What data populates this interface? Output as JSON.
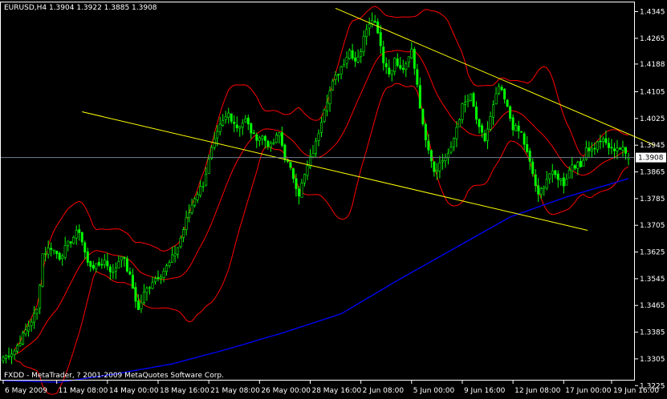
{
  "header": {
    "symbol_line": "EURUSD,H4  1.3904 1.3922 1.3885 1.3908"
  },
  "footer": {
    "copyright": "FXDD - MetaTrader, ? 2001-2009 MetaQuotes Software Corp."
  },
  "colors": {
    "background": "#000000",
    "frame": "#ffffff",
    "candle": "#00ff00",
    "bollinger": "#ff0000",
    "moving_average": "#0000ff",
    "trendline": "#ffff00",
    "price_line": "#708090",
    "price_label_bg": "#ffffff",
    "price_label_text": "#000000",
    "axis_text": "#ffffff"
  },
  "chart_data": {
    "type": "candlestick",
    "symbol": "EURUSD",
    "timeframe": "H4",
    "ohlc_current": {
      "open": 1.3904,
      "high": 1.3922,
      "low": 1.3885,
      "close": 1.3908
    },
    "current_price_label": "1.3908",
    "y_range": [
      1.324,
      1.4375
    ],
    "y_ticks": [
      {
        "value": 1.4345,
        "label": "1.4345"
      },
      {
        "value": 1.4265,
        "label": "1.4265"
      },
      {
        "value": 1.4188,
        "label": "1.4188"
      },
      {
        "value": 1.4105,
        "label": "1.4105"
      },
      {
        "value": 1.4025,
        "label": "1.4025"
      },
      {
        "value": 1.3945,
        "label": "1.3945"
      },
      {
        "value": 1.3865,
        "label": "1.3865"
      },
      {
        "value": 1.3785,
        "label": "1.3785"
      },
      {
        "value": 1.3705,
        "label": "1.3705"
      },
      {
        "value": 1.3625,
        "label": "1.3625"
      },
      {
        "value": 1.3545,
        "label": "1.3545"
      },
      {
        "value": 1.3465,
        "label": "1.3465"
      },
      {
        "value": 1.3385,
        "label": "1.3385"
      },
      {
        "value": 1.3305,
        "label": "1.3305"
      },
      {
        "value": 1.3225,
        "label": "1.3225"
      }
    ],
    "x_ticks": [
      {
        "bar": 0,
        "label": "6 May 2009"
      },
      {
        "bar": 19,
        "label": "11 May 08:00"
      },
      {
        "bar": 37,
        "label": "14 May 00:00"
      },
      {
        "bar": 55,
        "label": "18 May 16:00"
      },
      {
        "bar": 73,
        "label": "21 May 08:00"
      },
      {
        "bar": 91,
        "label": "26 May 00:00"
      },
      {
        "bar": 109,
        "label": "28 May 16:00"
      },
      {
        "bar": 127,
        "label": "2 Jun 08:00"
      },
      {
        "bar": 145,
        "label": "5 Jun 00:00"
      },
      {
        "bar": 163,
        "label": "9 Jun 16:00"
      },
      {
        "bar": 181,
        "label": "12 Jun 08:00"
      },
      {
        "bar": 199,
        "label": "17 Jun 00:00"
      },
      {
        "bar": 216,
        "label": "19 Jun 16:00"
      }
    ],
    "close_anchors": [
      [
        0,
        1.331
      ],
      [
        4,
        1.333
      ],
      [
        8,
        1.339
      ],
      [
        12,
        1.345
      ],
      [
        14,
        1.362
      ],
      [
        17,
        1.364
      ],
      [
        20,
        1.361
      ],
      [
        24,
        1.366
      ],
      [
        27,
        1.369
      ],
      [
        30,
        1.359
      ],
      [
        33,
        1.358
      ],
      [
        36,
        1.36
      ],
      [
        39,
        1.356
      ],
      [
        42,
        1.362
      ],
      [
        45,
        1.355
      ],
      [
        48,
        1.345
      ],
      [
        50,
        1.35
      ],
      [
        53,
        1.354
      ],
      [
        56,
        1.356
      ],
      [
        59,
        1.359
      ],
      [
        62,
        1.364
      ],
      [
        65,
        1.372
      ],
      [
        68,
        1.379
      ],
      [
        71,
        1.383
      ],
      [
        74,
        1.393
      ],
      [
        77,
        1.4
      ],
      [
        80,
        1.404
      ],
      [
        83,
        1.4
      ],
      [
        86,
        1.402
      ],
      [
        89,
        1.397
      ],
      [
        92,
        1.397
      ],
      [
        95,
        1.394
      ],
      [
        98,
        1.398
      ],
      [
        100,
        1.391
      ],
      [
        103,
        1.385
      ],
      [
        105,
        1.38
      ],
      [
        108,
        1.388
      ],
      [
        111,
        1.395
      ],
      [
        114,
        1.406
      ],
      [
        117,
        1.413
      ],
      [
        120,
        1.418
      ],
      [
        123,
        1.423
      ],
      [
        125,
        1.42
      ],
      [
        127,
        1.423
      ],
      [
        129,
        1.43
      ],
      [
        131,
        1.433
      ],
      [
        133,
        1.429
      ],
      [
        135,
        1.42
      ],
      [
        137,
        1.416
      ],
      [
        139,
        1.42
      ],
      [
        141,
        1.417
      ],
      [
        143,
        1.418
      ],
      [
        145,
        1.423
      ],
      [
        147,
        1.413
      ],
      [
        149,
        1.4
      ],
      [
        151,
        1.394
      ],
      [
        153,
        1.387
      ],
      [
        156,
        1.39
      ],
      [
        159,
        1.393
      ],
      [
        161,
        1.4
      ],
      [
        163,
        1.406
      ],
      [
        166,
        1.409
      ],
      [
        169,
        1.399
      ],
      [
        171,
        1.396
      ],
      [
        174,
        1.406
      ],
      [
        176,
        1.412
      ],
      [
        178,
        1.408
      ],
      [
        181,
        1.4
      ],
      [
        184,
        1.398
      ],
      [
        186,
        1.392
      ],
      [
        188,
        1.386
      ],
      [
        190,
        1.379
      ],
      [
        192,
        1.383
      ],
      [
        194,
        1.386
      ],
      [
        197,
        1.385
      ],
      [
        199,
        1.383
      ],
      [
        202,
        1.389
      ],
      [
        205,
        1.388
      ],
      [
        207,
        1.394
      ],
      [
        209,
        1.393
      ],
      [
        212,
        1.396
      ],
      [
        214,
        1.395
      ],
      [
        216,
        1.393
      ],
      [
        218,
        1.394
      ],
      [
        220,
        1.393
      ],
      [
        222,
        1.3908
      ]
    ],
    "moving_average_anchors": [
      [
        0,
        1.324
      ],
      [
        20,
        1.3235
      ],
      [
        40,
        1.326
      ],
      [
        60,
        1.329
      ],
      [
        80,
        1.3335
      ],
      [
        100,
        1.3385
      ],
      [
        120,
        1.344
      ],
      [
        140,
        1.354
      ],
      [
        160,
        1.3635
      ],
      [
        180,
        1.373
      ],
      [
        200,
        1.379
      ],
      [
        222,
        1.3845
      ]
    ],
    "trendlines": [
      {
        "from": [
          1.5,
          1.4045
        ],
        "to": [
          11.5,
          1.369
        ],
        "units": "[date_tick_index, price]"
      },
      {
        "from": [
          6.5,
          1.4355
        ],
        "to": [
          12.9,
          1.3945
        ],
        "units": "[date_tick_index, price]"
      }
    ]
  }
}
